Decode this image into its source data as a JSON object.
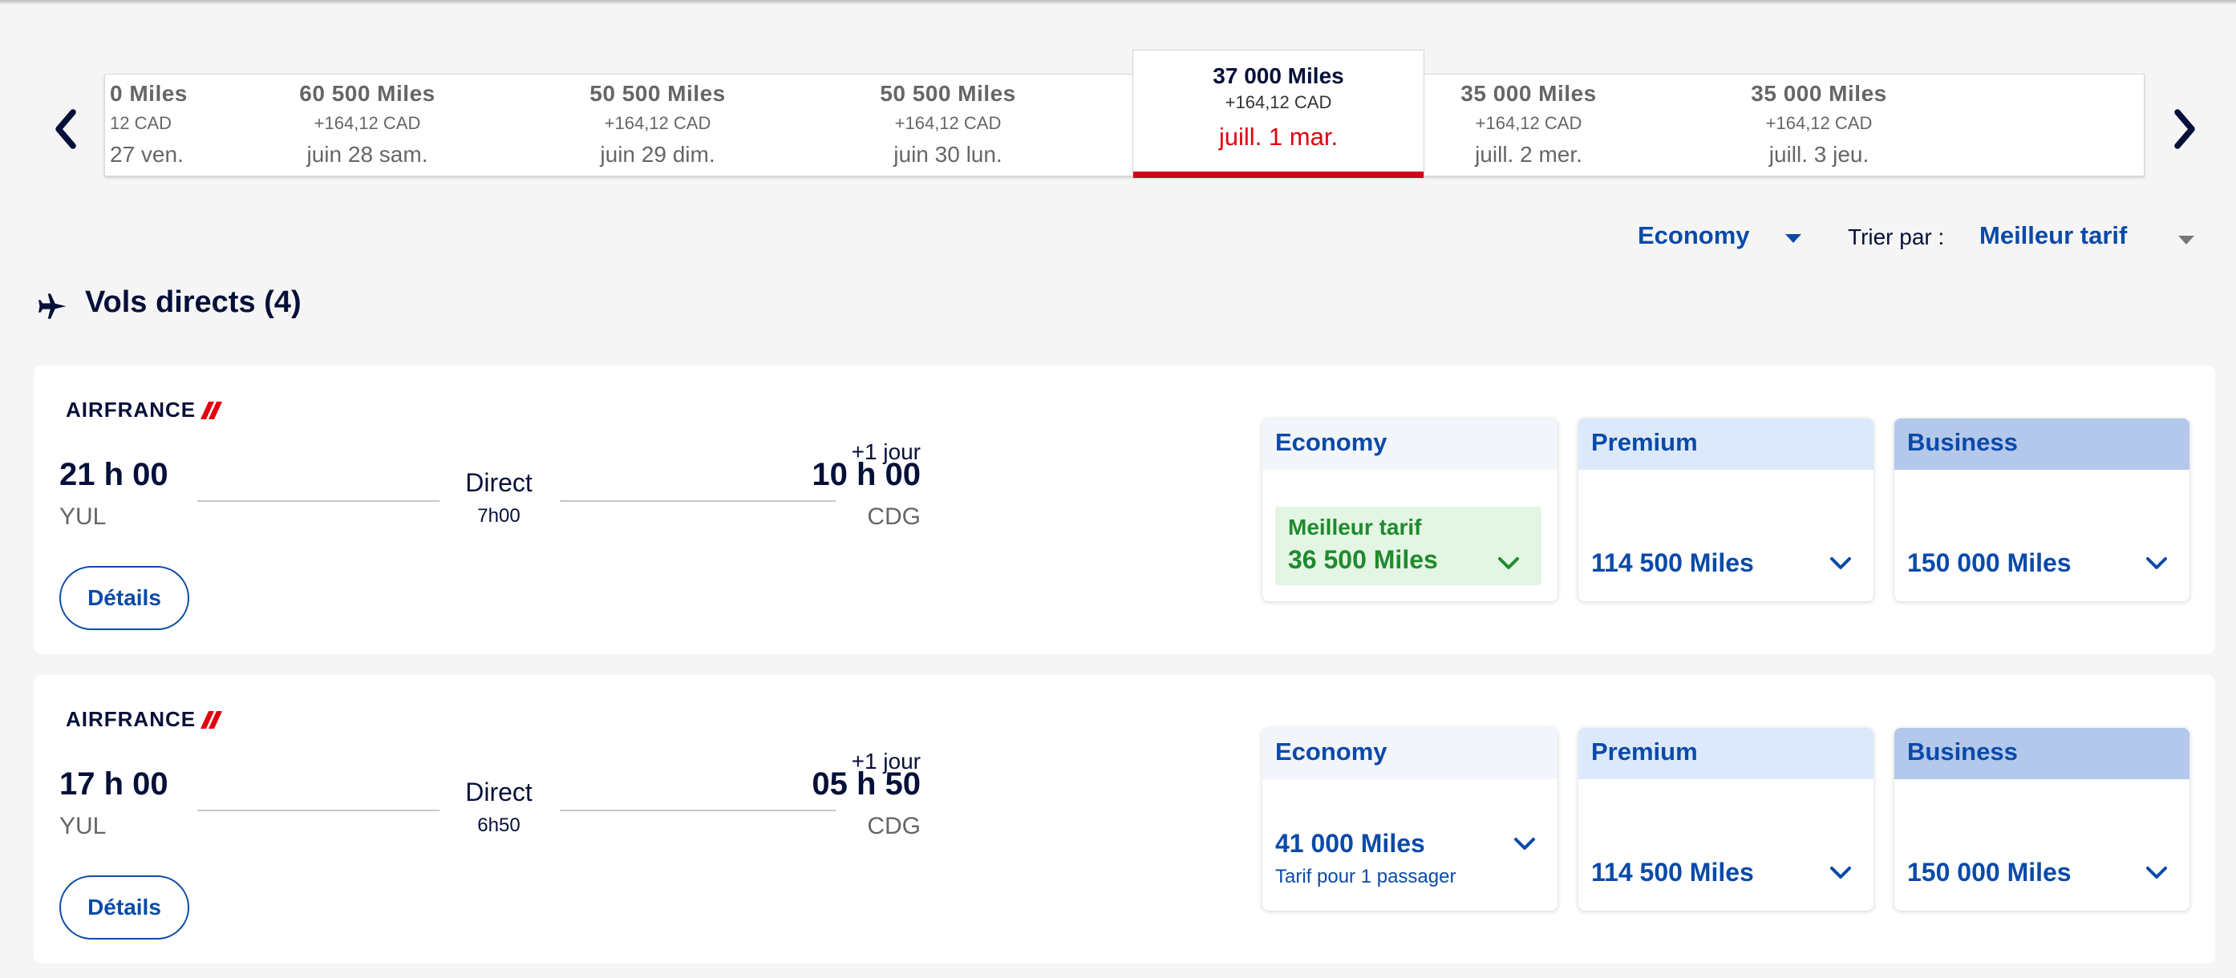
{
  "carousel": {
    "prev_icon": "chevron-left-icon",
    "next_icon": "chevron-right-icon",
    "days": [
      {
        "miles": "0  Miles",
        "cad": "12 CAD",
        "date": "27 ven."
      },
      {
        "miles": "60 500  Miles",
        "cad": "+164,12 CAD",
        "date": "juin 28 sam."
      },
      {
        "miles": "50 500  Miles",
        "cad": "+164,12 CAD",
        "date": "juin 29 dim."
      },
      {
        "miles": "50 500  Miles",
        "cad": "+164,12 CAD",
        "date": "juin 30 lun."
      },
      {
        "miles": "37 000  Miles",
        "cad": "+164,12 CAD",
        "date": "juill. 1 mar.",
        "selected": true
      },
      {
        "miles": "35 000  Miles",
        "cad": "+164,12 CAD",
        "date": "juill. 2 mer."
      },
      {
        "miles": "35 000  Miles",
        "cad": "+164,12 CAD",
        "date": "juill. 3 jeu."
      }
    ]
  },
  "filters": {
    "cabin": "Economy",
    "sort_label": "Trier par :",
    "sort_value": "Meilleur tarif"
  },
  "section": {
    "icon": "plane-icon",
    "title": "Vols directs (4)"
  },
  "flights": [
    {
      "airline": "AIRFRANCE",
      "departure_time": "21 h 00",
      "departure_code": "YUL",
      "stops": "Direct",
      "duration": "7h00",
      "arrival_plus": "+1 jour",
      "arrival_time": "10 h 00",
      "arrival_code": "CDG",
      "details": "Détails",
      "fares": {
        "economy": {
          "label": "Economy",
          "best_label": "Meilleur tarif",
          "price": "36 500  Miles"
        },
        "premium": {
          "label": "Premium",
          "price": "114 500  Miles"
        },
        "business": {
          "label": "Business",
          "price": "150 000  Miles"
        }
      }
    },
    {
      "airline": "AIRFRANCE",
      "departure_time": "17 h 00",
      "departure_code": "YUL",
      "stops": "Direct",
      "duration": "6h50",
      "arrival_plus": "+1 jour",
      "arrival_time": "05 h 50",
      "arrival_code": "CDG",
      "details": "Détails",
      "fares": {
        "economy": {
          "label": "Economy",
          "price": "41 000  Miles",
          "note": "Tarif pour 1 passager"
        },
        "premium": {
          "label": "Premium",
          "price": "114 500  Miles"
        },
        "business": {
          "label": "Business",
          "price": "150 000  Miles"
        }
      }
    }
  ],
  "colors": {
    "accent": "#0a4aa8",
    "navy": "#051039",
    "selected_red": "#d0021b",
    "best_green": "#1f8a2e"
  }
}
